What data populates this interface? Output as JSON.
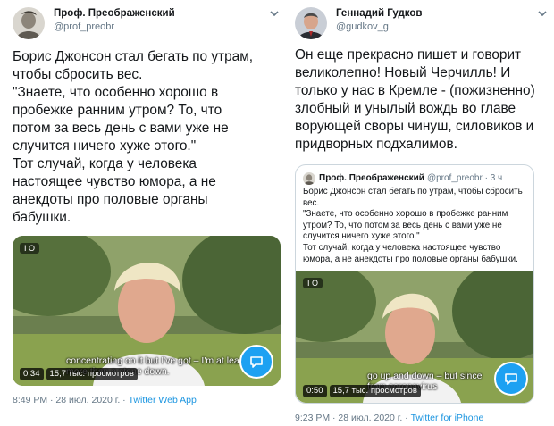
{
  "left_tweet": {
    "display_name": "Проф. Преображенский",
    "handle": "@prof_preobr",
    "text": "Борис Джонсон стал бегать по утрам,\nчтобы сбросить вес.\n\"Знаете, что особенно хорошо в\nпробежке ранним утром? То, что\nпотом за весь день с вами уже не\nслучится ничего хуже этого.\"\nТот случай, когда у человека\nнастоящее чувство юмора, а не\nанекдоты про половые органы\nбабушки.",
    "video": {
      "badge": "I O",
      "subtitle": "concentrating on it but I've got – I'm at least\n                                   more than a stone down.",
      "duration": "0:34",
      "views": "15,7 тыс. просмотров"
    },
    "timestamp": "8:49 PM · 28 июл. 2020 г.",
    "separator": " · ",
    "source": "Twitter Web App"
  },
  "right_tweet": {
    "display_name": "Геннадий Гудков",
    "handle": "@gudkov_g",
    "text": "Он еще прекрасно пишет и говорит\nвеликолепно! Новый Черчилль! И\nтолько у нас в Кремле - (пожизненно)\nзлобный и унылый вождь во главе\nворующей своры чинуш, силовиков и\nпридворных подхалимов.",
    "quoted": {
      "display_name": "Проф. Преображенский",
      "handle": "@prof_preobr · 3 ч",
      "text": "Борис Джонсон стал бегать по утрам, чтобы сбросить\nвес.\n\"Знаете, что особенно хорошо в пробежке ранним\nутром? То, что потом за весь день с вами уже не\nслучится ничего хуже этого.\"\nТот случай, когда у человека настоящее чувство\nюмора, а не анекдоты про половые органы бабушки.",
      "video": {
        "badge": "I O",
        "subtitle": "go up and down – but since\n           from coronavirus",
        "duration": "0:50",
        "views": "15,7 тыс. просмотров"
      }
    },
    "timestamp": "9:23 PM · 28 июл. 2020 г.",
    "separator": " · ",
    "source": "Twitter for iPhone"
  },
  "colors": {
    "accent": "#1da1f2",
    "link": "#1b95e0",
    "muted": "#657786",
    "text": "#14171a",
    "border": "#ccd6dd"
  },
  "icons": {
    "caret": "chevron-down-icon",
    "play": "comment-bubble-icon",
    "gif_badge": "sound-icon"
  }
}
